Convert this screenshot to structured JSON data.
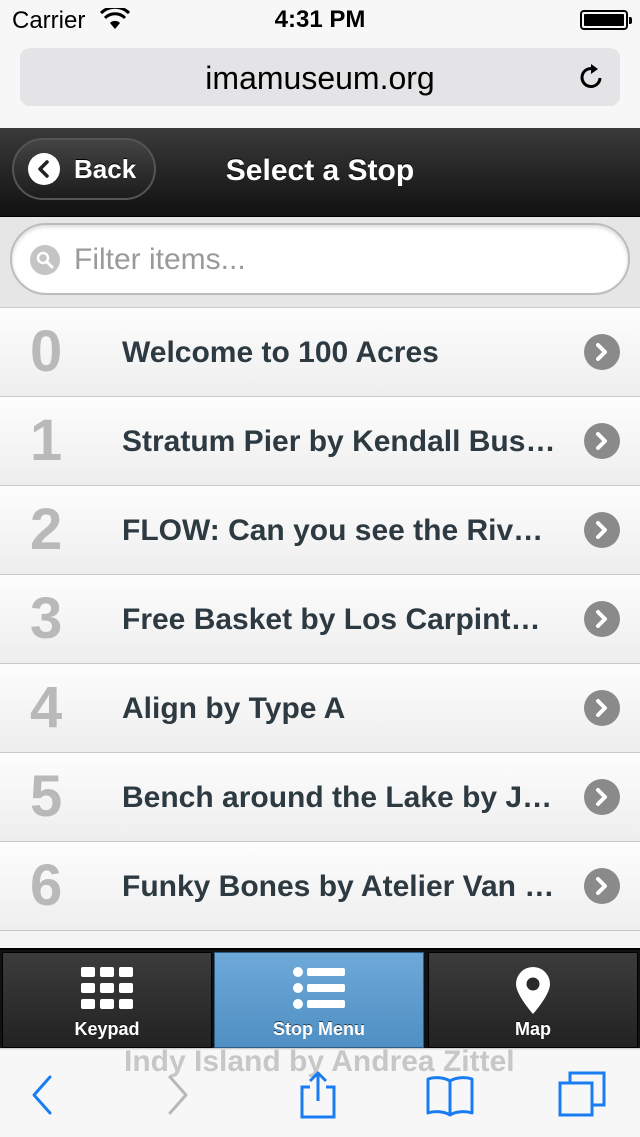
{
  "status_bar": {
    "carrier": "Carrier",
    "time": "4:31 PM"
  },
  "browser": {
    "url": "imamuseum.org"
  },
  "header": {
    "back_label": "Back",
    "title": "Select a Stop"
  },
  "filter": {
    "placeholder": "Filter items..."
  },
  "stops": [
    {
      "number": "0",
      "title": "Welcome to 100 Acres"
    },
    {
      "number": "1",
      "title": "Stratum Pier by Kendall Buster"
    },
    {
      "number": "2",
      "title": "FLOW: Can you see the River?"
    },
    {
      "number": "3",
      "title": "Free Basket by Los Carpinteros"
    },
    {
      "number": "4",
      "title": "Align by Type A"
    },
    {
      "number": "5",
      "title": "Bench around the Lake by Jeppe Hein"
    },
    {
      "number": "6",
      "title": "Funky Bones by Atelier Van Lieshout"
    }
  ],
  "tabs": [
    {
      "label": "Keypad",
      "icon": "keypad-icon"
    },
    {
      "label": "Stop Menu",
      "icon": "list-icon"
    },
    {
      "label": "Map",
      "icon": "map-pin-icon"
    }
  ],
  "toolbar": {
    "ghost_text": "Indy Island by Andrea Zittel"
  },
  "colors": {
    "accent": "#5b9bd0",
    "ios_blue": "#1a7cf3",
    "header_dark": "#1a1a1a"
  }
}
